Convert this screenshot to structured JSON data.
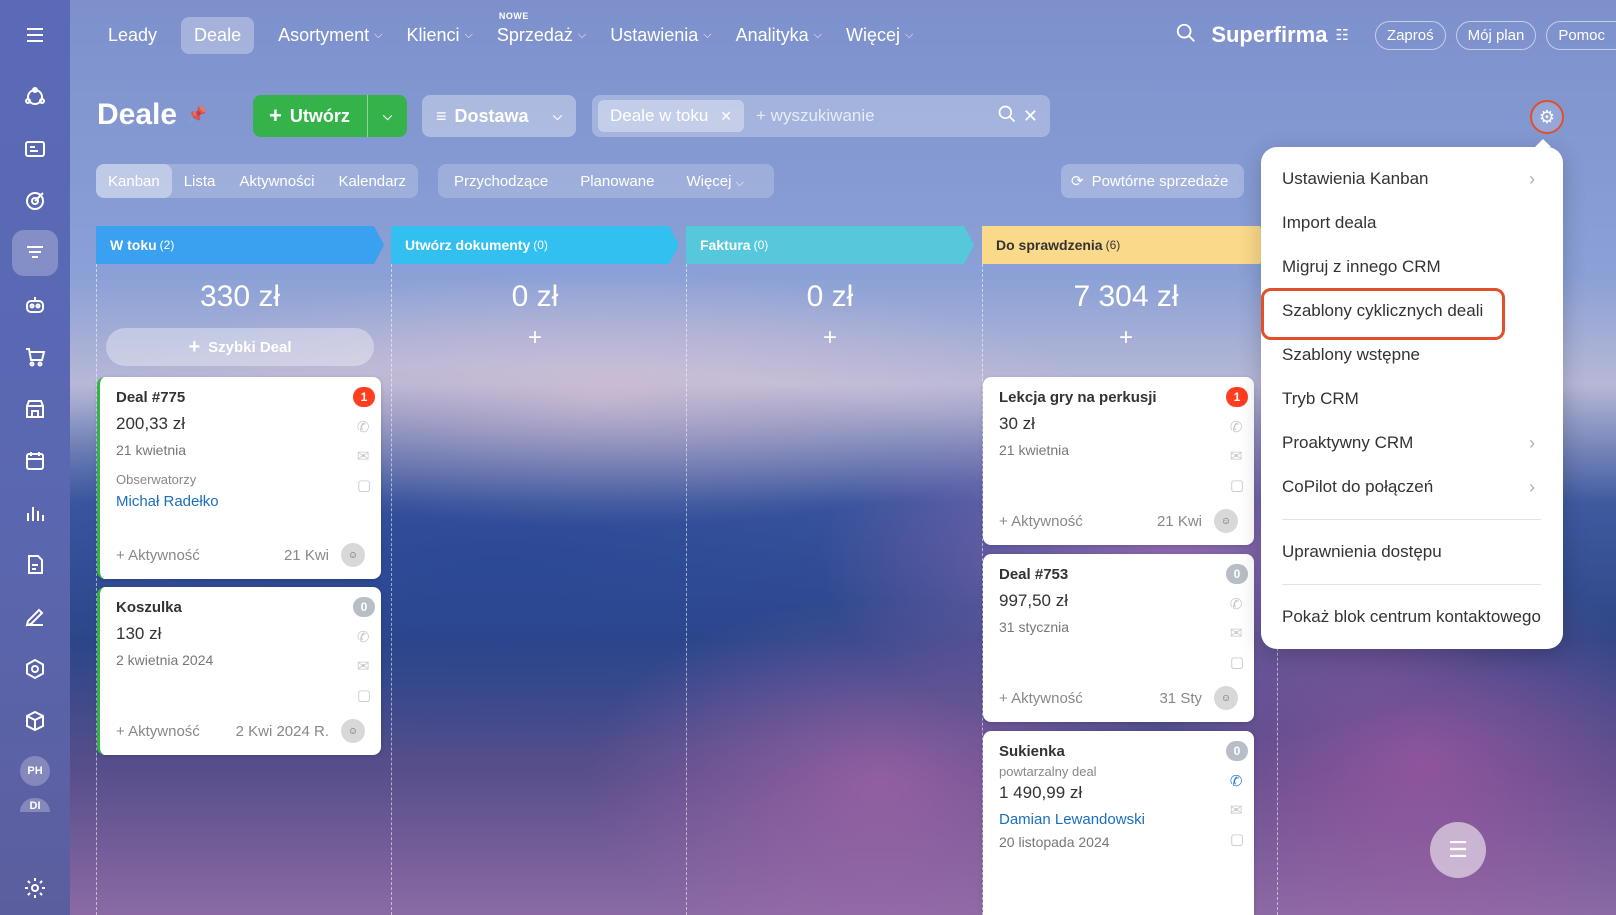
{
  "nav": {
    "items": [
      {
        "label": "Leady",
        "chevron": false,
        "active": false
      },
      {
        "label": "Deale",
        "chevron": false,
        "active": true
      },
      {
        "label": "Asortyment",
        "chevron": true,
        "active": false
      },
      {
        "label": "Klienci",
        "chevron": true,
        "active": false
      },
      {
        "label": "Sprzedaż",
        "chevron": true,
        "active": false,
        "badge": "NOWE"
      },
      {
        "label": "Ustawienia",
        "chevron": true,
        "active": false
      },
      {
        "label": "Analityka",
        "chevron": true,
        "active": false
      },
      {
        "label": "Więcej",
        "chevron": true,
        "active": false
      }
    ],
    "brand": "Superfirma",
    "buttons": [
      "Zaproś",
      "Mój plan",
      "Pomoc"
    ]
  },
  "rail": {
    "icons": [
      "menu-icon",
      "leads-icon",
      "contacts-card-icon",
      "target-icon",
      "funnel-icon",
      "robot-icon",
      "cart-icon",
      "store-icon",
      "calendar-icon",
      "analytics-icon",
      "document-edit-icon",
      "pen-icon",
      "hexagon-icon",
      "box-icon"
    ],
    "avatars": [
      "PH",
      "DI"
    ]
  },
  "header": {
    "title": "Deale",
    "create_label": "Utwórz",
    "funnel_label": "Dostawa",
    "filter_chip": "Deale w toku",
    "search_placeholder": "+ wyszukiwanie"
  },
  "views": {
    "modes": [
      "Kanban",
      "Lista",
      "Aktywności",
      "Kalendarz"
    ],
    "active": "Kanban",
    "subfilters": [
      "Przychodzące",
      "Planowane",
      "Więcej"
    ],
    "repeat_sales": "Powtórne sprzedaże"
  },
  "columns": [
    {
      "title": "W toku",
      "count": "(2)",
      "sum": "330 zł",
      "color": "#3aa0f0",
      "quick_deal": "Szybki Deal"
    },
    {
      "title": "Utwórz dokumenty",
      "count": "(0)",
      "sum": "0 zł",
      "color": "#31c0f0"
    },
    {
      "title": "Faktura",
      "count": "(0)",
      "sum": "0 zł",
      "color": "#55c8dc"
    },
    {
      "title": "Do sprawdzenia",
      "count": "(6)",
      "sum": "7 304 zł",
      "color": "#fbd98a"
    }
  ],
  "cards": [
    {
      "id": "c1",
      "title": "Deal #775",
      "amount": "200,33 zł",
      "date": "21 kwietnia",
      "observers_label": "Obserwatorzy",
      "observer": "Michał Radełko",
      "activity": "+ Aktywność",
      "foot_date": "21 Kwi",
      "badge": "1",
      "badge_color": "red"
    },
    {
      "id": "c2",
      "title": "Koszulka",
      "amount": "130 zł",
      "date": "2 kwietnia 2024",
      "activity": "+ Aktywność",
      "foot_date": "2 Kwi 2024 R.",
      "badge": "0",
      "badge_color": "gray"
    },
    {
      "id": "c3",
      "title": "Lekcja gry na perkusji",
      "amount": "30 zł",
      "date": "21 kwietnia",
      "activity": "+ Aktywność",
      "foot_date": "21 Kwi",
      "badge": "1",
      "badge_color": "red"
    },
    {
      "id": "c4",
      "title": "Deal #753",
      "amount": "997,50 zł",
      "date": "31 stycznia",
      "activity": "+ Aktywność",
      "foot_date": "31 Sty",
      "badge": "0",
      "badge_color": "gray"
    },
    {
      "id": "c5",
      "title": "Sukienka",
      "subtitle": "powtarzalny deal",
      "amount": "1 490,99 zł",
      "person": "Damian Lewandowski",
      "date": "20 listopada 2024",
      "badge": "0",
      "badge_color": "gray"
    }
  ],
  "menu": {
    "items": [
      {
        "label": "Ustawienia Kanban",
        "submenu": true
      },
      {
        "label": "Import deala",
        "submenu": false
      },
      {
        "label": "Migruj z innego CRM",
        "submenu": false
      },
      {
        "label": "Szablony cyklicznych deali",
        "submenu": false,
        "highlight": true
      },
      {
        "label": "Szablony wstępne",
        "submenu": false
      },
      {
        "label": "Tryb CRM",
        "submenu": false
      },
      {
        "label": "Proaktywny CRM",
        "submenu": true
      },
      {
        "label": "CoPilot do połączeń",
        "submenu": true
      }
    ],
    "items2": [
      {
        "label": "Uprawnienia dostępu"
      },
      {
        "label": "Pokaż blok centrum kontaktowego"
      }
    ]
  },
  "colors": {
    "accent_green": "#35b34a",
    "highlight": "#e0502a",
    "link": "#1a6fbf"
  }
}
